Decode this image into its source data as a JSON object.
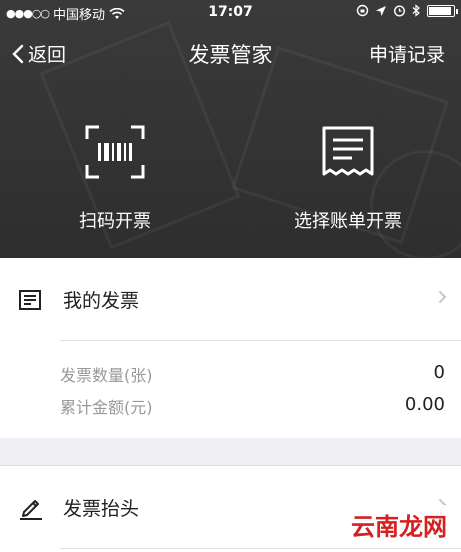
{
  "status_bar": {
    "signal": "●●●○○",
    "carrier": "中国移动",
    "time": "17:07"
  },
  "nav": {
    "back_label": "返回",
    "title": "发票管家",
    "right_label": "申请记录"
  },
  "actions": [
    {
      "label": "扫码开票",
      "icon": "barcode-scan-icon"
    },
    {
      "label": "选择账单开票",
      "icon": "receipt-icon"
    }
  ],
  "my_invoices": {
    "title": "我的发票",
    "icon": "invoice-list-icon",
    "stats": [
      {
        "label": "发票数量(张)",
        "value": "0"
      },
      {
        "label": "累计金额(元)",
        "value": "0.00"
      }
    ]
  },
  "invoice_header": {
    "title": "发票抬头",
    "icon": "pencil-icon"
  },
  "watermark": "云南龙网",
  "colors": {
    "header_bg": "#333333",
    "page_bg": "#f0eff4",
    "card_bg": "#ffffff",
    "muted_text": "#999999",
    "watermark": "#d42020"
  }
}
